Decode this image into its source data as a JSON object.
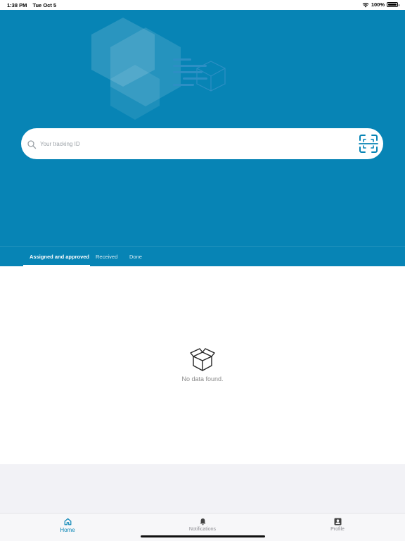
{
  "status_bar": {
    "time": "1:38 PM",
    "date": "Tue Oct 5",
    "battery": "100%",
    "wifi_icon": "wifi-icon",
    "battery_icon": "battery-icon"
  },
  "search": {
    "placeholder": "Your tracking ID",
    "icon": "search-icon",
    "scan_icon": "scan-icon"
  },
  "tabs": [
    {
      "label": "Assigned and approved",
      "active": true
    },
    {
      "label": "Received",
      "active": false
    },
    {
      "label": "Done",
      "active": false
    }
  ],
  "empty_state": {
    "icon": "empty-box-icon",
    "message": "No data found."
  },
  "bottom_nav": [
    {
      "label": "Home",
      "icon": "home-icon",
      "active": true
    },
    {
      "label": "Notifications",
      "icon": "bell-icon",
      "active": false
    },
    {
      "label": "Profile",
      "icon": "profile-icon",
      "active": false
    }
  ],
  "colors": {
    "primary": "#0784b5",
    "background": "#f2f2f6",
    "inactive": "#8e8e93"
  }
}
